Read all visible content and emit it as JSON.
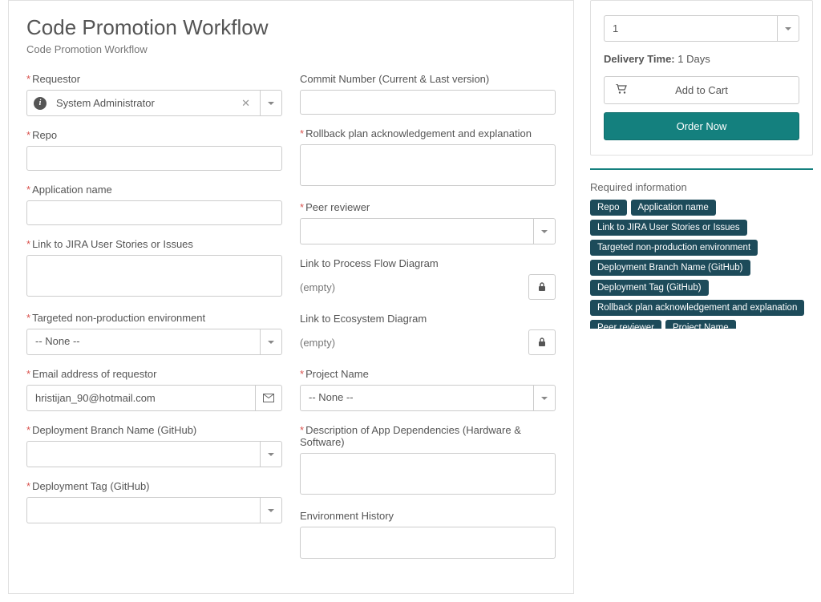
{
  "header": {
    "title": "Code Promotion Workflow",
    "subtitle": "Code Promotion Workflow"
  },
  "form": {
    "left": {
      "requestor": {
        "label": "Requestor",
        "required": true,
        "value": "System Administrator"
      },
      "repo": {
        "label": "Repo",
        "required": true,
        "value": ""
      },
      "app_name": {
        "label": "Application name",
        "required": true,
        "value": ""
      },
      "jira": {
        "label": "Link to JIRA User Stories or Issues",
        "required": true,
        "value": ""
      },
      "target_env": {
        "label": "Targeted non-production environment",
        "required": true,
        "value": "-- None --"
      },
      "email": {
        "label": "Email address of requestor",
        "required": true,
        "value": "hristijan_90@hotmail.com"
      },
      "branch": {
        "label": "Deployment Branch Name (GitHub)",
        "required": true,
        "value": ""
      },
      "tag": {
        "label": "Deployment Tag (GitHub)",
        "required": true,
        "value": ""
      }
    },
    "right": {
      "commit": {
        "label": "Commit Number (Current & Last version)",
        "required": false,
        "value": ""
      },
      "rollback": {
        "label": "Rollback plan acknowledgement and explanation",
        "required": true,
        "value": ""
      },
      "peer": {
        "label": "Peer reviewer",
        "required": true,
        "value": ""
      },
      "processflow": {
        "label": "Link to Process Flow Diagram",
        "required": false,
        "empty_text": "(empty)"
      },
      "ecosystem": {
        "label": "Link to Ecosystem Diagram",
        "required": false,
        "empty_text": "(empty)"
      },
      "project": {
        "label": "Project Name",
        "required": true,
        "value": "-- None --"
      },
      "dependencies": {
        "label": "Description of App Dependencies (Hardware & Software)",
        "required": true,
        "value": ""
      },
      "env_history": {
        "label": "Environment History",
        "required": false,
        "value": ""
      }
    }
  },
  "order": {
    "quantity": "1",
    "delivery_label": "Delivery Time:",
    "delivery_value": "1 Days",
    "add_to_cart": "Add to Cart",
    "order_now": "Order Now"
  },
  "required_info": {
    "title": "Required information",
    "tags": [
      "Repo",
      "Application name",
      "Link to JIRA User Stories or Issues",
      "Targeted non-production environment",
      "Deployment Branch Name (GitHub)",
      "Deployment Tag (GitHub)",
      "Rollback plan acknowledgement and explanation",
      "Peer reviewer",
      "Project Name"
    ]
  },
  "icons": {
    "info": "i",
    "clear": "✕"
  }
}
